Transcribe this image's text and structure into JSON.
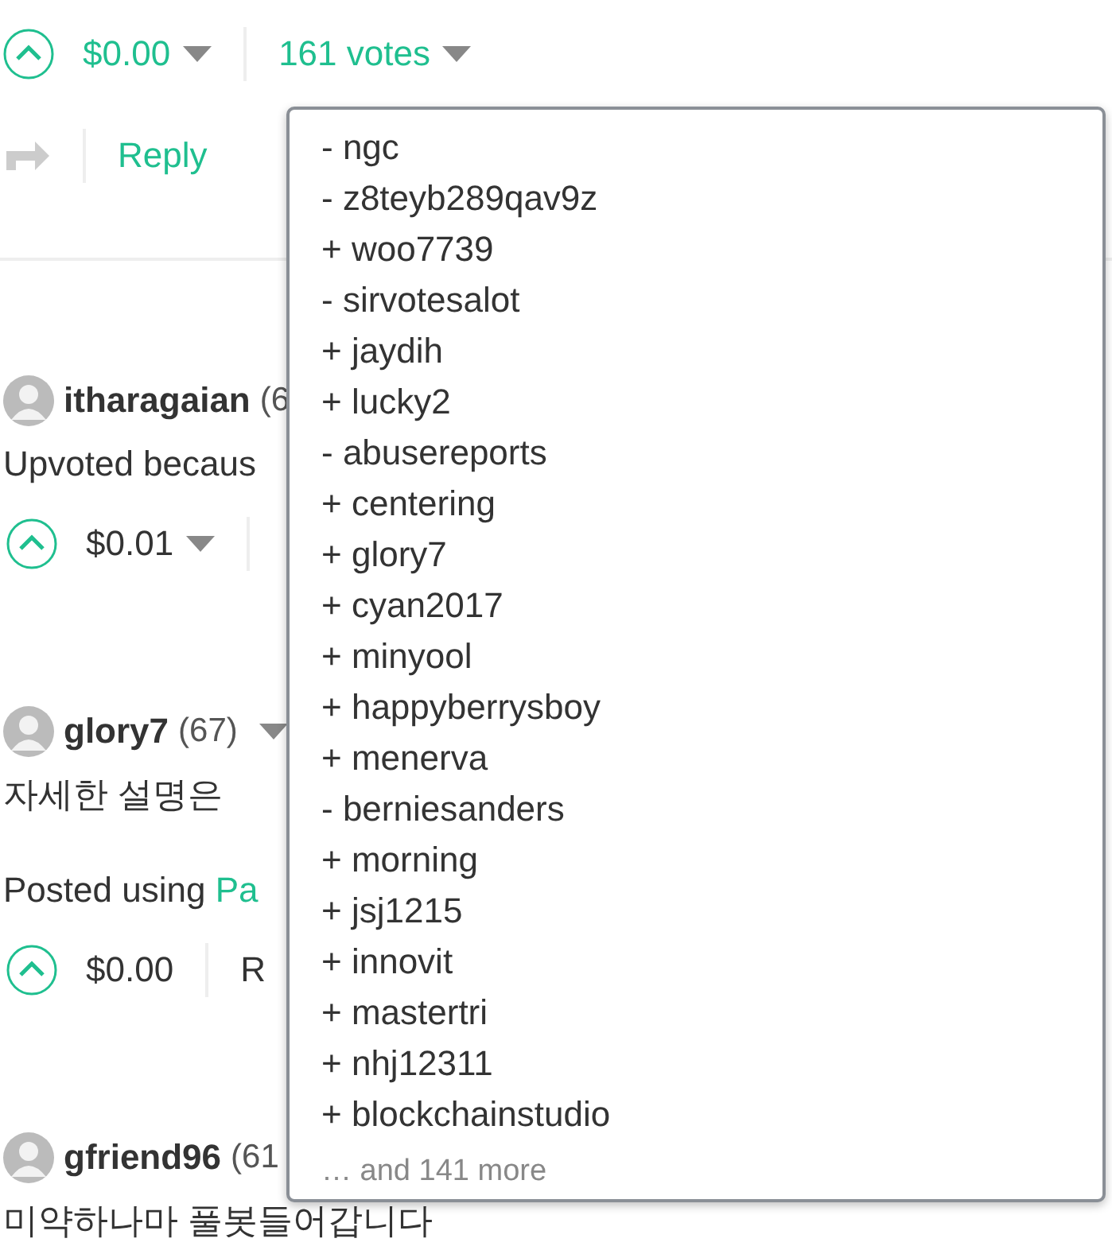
{
  "post_footer": {
    "voted": true,
    "payout": "$0.00",
    "votes": "161 votes",
    "reply": "Reply"
  },
  "votes_menu": {
    "items": [
      "- ngc",
      "- z8teyb289qav9z",
      "+ woo7739",
      "- sirvotesalot",
      "+ jaydih",
      "+ lucky2",
      "- abusereports",
      "+ centering",
      "+ glory7",
      "+ cyan2017",
      "+ minyool",
      "+ happyberrysboy",
      "+ menerva",
      "- berniesanders",
      "+ morning",
      "+ jsj1215",
      "+ innovit",
      "+ mastertri",
      "+ nhj12311",
      "+ blockchainstudio"
    ],
    "more": "… and 141 more"
  },
  "comments": [
    {
      "author": "itharagaian",
      "reputation": "(6",
      "body": [
        {
          "text": "Upvoted becaus"
        }
      ],
      "payout": "$0.01",
      "payout_menu": true
    },
    {
      "author": "glory7",
      "reputation": "(67)",
      "author_menu": true,
      "body": [
        {
          "text": "자세한 설명은"
        },
        {
          "text": "Posted using ",
          "link": "Pa"
        }
      ],
      "payout": "$0.00",
      "payout_menu": false,
      "reply": "R"
    },
    {
      "author": "gfriend96",
      "reputation": "(61",
      "body": [
        {
          "text": "미약하나마 풀봇들어갑니다"
        }
      ]
    }
  ]
}
